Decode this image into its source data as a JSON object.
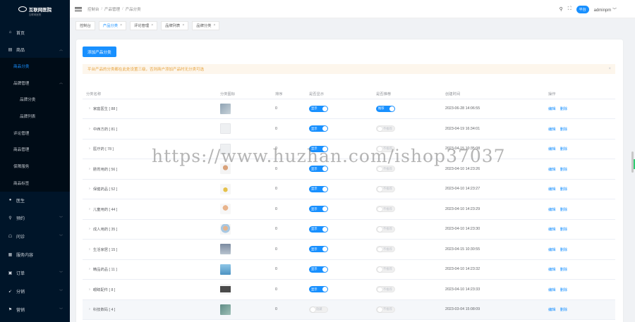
{
  "app": {
    "name": "互联网医院",
    "subtitle": "互联网医院"
  },
  "sidebar": {
    "items": [
      {
        "label": "首页",
        "icon": "home-icon"
      },
      {
        "label": "商品",
        "icon": "shop-icon"
      },
      {
        "label": "医生",
        "icon": "doctor-icon"
      },
      {
        "label": "预约",
        "icon": "appointment-icon"
      },
      {
        "label": "问诊",
        "icon": "consult-icon"
      },
      {
        "label": "服务内容",
        "icon": "service-icon"
      },
      {
        "label": "订单",
        "icon": "order-icon"
      },
      {
        "label": "分销",
        "icon": "share-icon"
      },
      {
        "label": "营销",
        "icon": "flag-icon"
      }
    ],
    "goods_sub": [
      {
        "label": "商品分类"
      },
      {
        "label": "品牌管理"
      },
      {
        "label": "品牌分类"
      },
      {
        "label": "品牌列表"
      },
      {
        "label": "评论管理"
      },
      {
        "label": "商品管理"
      },
      {
        "label": "保障服务"
      },
      {
        "label": "商品标签"
      }
    ]
  },
  "header": {
    "breadcrumb": [
      "控制台",
      "产品管理",
      "产品分类"
    ],
    "platform": "平台",
    "admin": "adminpm"
  },
  "tabs": [
    {
      "label": "控制台",
      "closable": false
    },
    {
      "label": "产品分类",
      "closable": true
    },
    {
      "label": "评论管理",
      "closable": true
    },
    {
      "label": "品牌列表",
      "closable": true
    },
    {
      "label": "品牌分类",
      "closable": true
    }
  ],
  "main": {
    "add_button": "添加产品分类",
    "alert": "平台产品的分类都在此处设置三级，否则商户添加产品时无分类可选",
    "columns": [
      "分类名称",
      "分类图标",
      "排序",
      "是否显示",
      "是否推荐",
      "创建时间",
      "操作"
    ],
    "show_on": "显示",
    "show_off": "隐藏",
    "rec_on": "推荐",
    "rec_off": "不推荐",
    "edit": "编辑",
    "delete": "删除",
    "rows": [
      {
        "name": "家庭医生 [ 88 ]",
        "sort": "0",
        "show": true,
        "rec": true,
        "time": "2023-06-28 14:06:55"
      },
      {
        "name": "中西方药 [ 81 ]",
        "sort": "0",
        "show": true,
        "rec": false,
        "time": "2023-04-19 16:34:01"
      },
      {
        "name": "医疗药 [ 78 ]",
        "sort": "0",
        "show": true,
        "rec": false,
        "time": "2023-04-15 10:35:08"
      },
      {
        "name": "肠胃用药 [ 56 ]",
        "sort": "0",
        "show": true,
        "rec": false,
        "time": "2023-04-10 14:23:26"
      },
      {
        "name": "保健药品 [ 52 ]",
        "sort": "0",
        "show": true,
        "rec": false,
        "time": "2023-04-10 14:23:27"
      },
      {
        "name": "儿童用药 [ 44 ]",
        "sort": "0",
        "show": true,
        "rec": false,
        "time": "2023-04-10 14:23:29"
      },
      {
        "name": "成人用药 [ 35 ]",
        "sort": "0",
        "show": true,
        "rec": false,
        "time": "2023-04-10 14:23:30"
      },
      {
        "name": "生活家居 [ 15 ]",
        "sort": "0",
        "show": true,
        "rec": false,
        "time": "2023-04-15 10:30:55"
      },
      {
        "name": "精品药品 [ 11 ]",
        "sort": "0",
        "show": true,
        "rec": false,
        "time": "2023-04-10 14:23:32"
      },
      {
        "name": "眼睛配件 [ 8 ]",
        "sort": "0",
        "show": true,
        "rec": false,
        "time": "2023-04-10 14:23:33"
      },
      {
        "name": "科技数码 [ 4 ]",
        "sort": "0",
        "show": false,
        "rec": false,
        "time": "2023-03-04 15:08:09"
      }
    ]
  },
  "watermark": "https://www.huzhan.com/ishop37037",
  "colors": {
    "sidebar_bg": "#001529",
    "accent": "#1890ff",
    "alert_text": "#e6a23c",
    "alert_bg": "#fdf6ec"
  }
}
